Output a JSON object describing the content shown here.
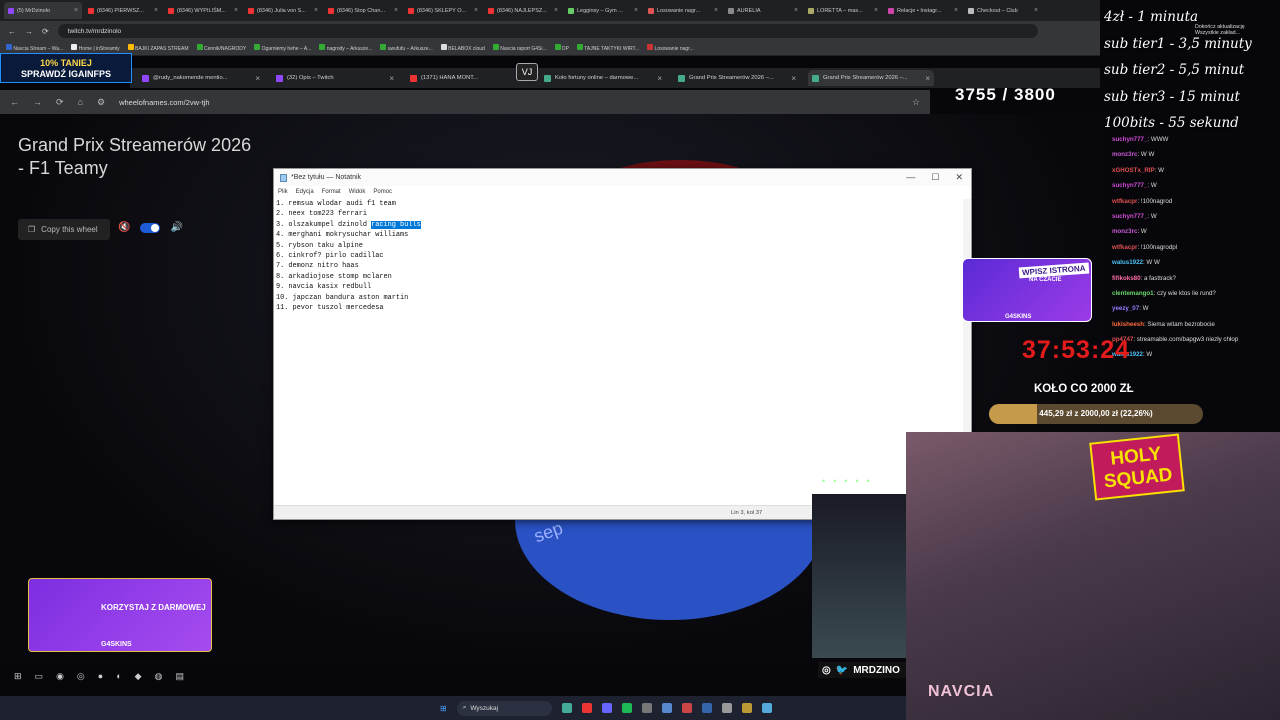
{
  "outer_browser": {
    "tabs": [
      "(5) MrDzinolo",
      "(8346) PIERWSZ...",
      "(8346) WYPILIŚM...",
      "(8346) Julia von S...",
      "(8346) Stop Chan...",
      "(8346) SKLEPY O...",
      "(8346) NAJLEPSZ...",
      "Legginsy – Gym ...",
      "Losowanie nagr...",
      "AURELIA",
      "LORETTA – mas...",
      "Relacje • Instagr...",
      "Checkout – Club"
    ],
    "url": "twitch.tv/mrdzinolo",
    "bookmarks": [
      "Navcia Stream – Wa...",
      "Home | inStreamly",
      "BAJKI ZAPAS STREAM",
      "Cennik/NAGRODY",
      "Ogarniemy hehe – A...",
      "nagrody – Arkusze...",
      "uwufufu – Arkusze...",
      "BELABOX cloud",
      "Navcia raport G4Si...",
      "DP",
      "TAJNE TAKTYKI WIRT...",
      "Losowanie nagr..."
    ],
    "update_text": "Dokończ aktualizację",
    "all_bookmarks": "Wszystkie zakład..."
  },
  "inner_browser": {
    "tabs": [
      "@rudy_nakomende mentio...",
      "(32) Opis – Twitch",
      "(1371) HANA MONT...",
      "Koło fortuny online – darmowe...",
      "Grand Prix Streamerów 2026 –...",
      "Grand Prix Streamerów 2026 –..."
    ],
    "url": "wheelofnames.com/2vw-tjh"
  },
  "wheel_page": {
    "title": "Grand Prix Streamerów 2026 - F1 Teamy",
    "copy_label": "Copy this wheel",
    "wheel_fragment": "sep"
  },
  "notepad": {
    "title": "*Bez tytułu — Notatnik",
    "menu": [
      "Plik",
      "Edycja",
      "Format",
      "Widok",
      "Pomoc"
    ],
    "lines": [
      {
        "pre": "1. remsua wlodar audi f1 team",
        "sel": "",
        "post": ""
      },
      {
        "pre": "2. neex tom223 ferrari",
        "sel": "",
        "post": ""
      },
      {
        "pre": "3. olszakumpel dzinold ",
        "sel": "racing bulls",
        "post": ""
      },
      {
        "pre": "4. merghani mokrysuchar williams",
        "sel": "",
        "post": ""
      },
      {
        "pre": "5. rybson taku alpine",
        "sel": "",
        "post": ""
      },
      {
        "pre": "6. cinkrof? pirlo cadillac",
        "sel": "",
        "post": ""
      },
      {
        "pre": "7. demonz nitro haas",
        "sel": "",
        "post": ""
      },
      {
        "pre": "8. arkadiojose stomp mclaren",
        "sel": "",
        "post": ""
      },
      {
        "pre": "9. navcia kasix redbull",
        "sel": "",
        "post": ""
      },
      {
        "pre": "10. japczan bandura aston martin",
        "sel": "",
        "post": ""
      },
      {
        "pre": "11. pevor tuszol mercedesa",
        "sel": "",
        "post": ""
      }
    ],
    "status": "Lin 3, kol 37"
  },
  "overlays": {
    "gain_banner_line1": "10% TANIEJ",
    "gain_banner_line2": "SPRAWDŹ IGAINFPS",
    "counter": "3755 / 3800",
    "rates": [
      "4zł - 1 minuta",
      "sub tier1 - 3,5 minuty",
      "sub tier2 - 5,5 minut",
      "sub tier3 - 15 minut",
      "100bits - 55 sekund"
    ],
    "timer": "37:53:24",
    "kolo": "KOŁO CO 2000 ZŁ",
    "progress_text": "445,29 zł z 2000,00 zł (22,26%)",
    "progress_fraction": 0.2226,
    "ad1_line1": "WPISZ ISTRONA",
    "ad1_line2": "NA CZACIE",
    "ad1_brand": "G4SKINS",
    "ad2_line1": "KORZYSTAJ Z DARMOWEJ",
    "ad2_brand": "G4SKINS",
    "holy_squad": "HOLY SQUAD",
    "social_handle": "MRDZINO",
    "cam_name": "NAVCIA",
    "vj": "VJ"
  },
  "chat": [
    {
      "user": "suchyn777_",
      "msg": ": WWW",
      "color": "#d24bd8"
    },
    {
      "user": "monz3rc",
      "msg": ": W W",
      "color": "#c95ad8"
    },
    {
      "user": "xGHOSTx_RIP",
      "msg": ": W",
      "color": "#e05050"
    },
    {
      "user": "suchyn777_",
      "msg": ": W",
      "color": "#d24bd8"
    },
    {
      "user": "wtfkacpr",
      "msg": ": !100nagrod",
      "color": "#e05050"
    },
    {
      "user": "suchyn777_",
      "msg": ": W",
      "color": "#d24bd8"
    },
    {
      "user": "monz3rc",
      "msg": ": W",
      "color": "#c95ad8"
    },
    {
      "user": "wtfkacpr",
      "msg": ": !100nagrodpl",
      "color": "#e05050"
    },
    {
      "user": "walus1922",
      "msg": ": W W",
      "color": "#4fc3f7"
    },
    {
      "user": "fifikoks80",
      "msg": ": a fasttrack?",
      "color": "#ff6fa8"
    },
    {
      "user": "clentemango1",
      "msg": ": czy wie ktos lie rund?",
      "color": "#6cd96c"
    },
    {
      "user": "yeezy_07",
      "msg": ": W",
      "color": "#9a7cff"
    },
    {
      "user": "lukisheesh",
      "msg": ": Siema witam bezrobocie",
      "color": "#ff6a3d"
    },
    {
      "user": "pp4747",
      "msg": ": streamable.com/bapgw3 niezły chłop",
      "color": "#e05050"
    },
    {
      "user": "walus1922",
      "msg": ": W",
      "color": "#4fc3f7"
    }
  ],
  "taskbar_search": "Wyszukaj"
}
